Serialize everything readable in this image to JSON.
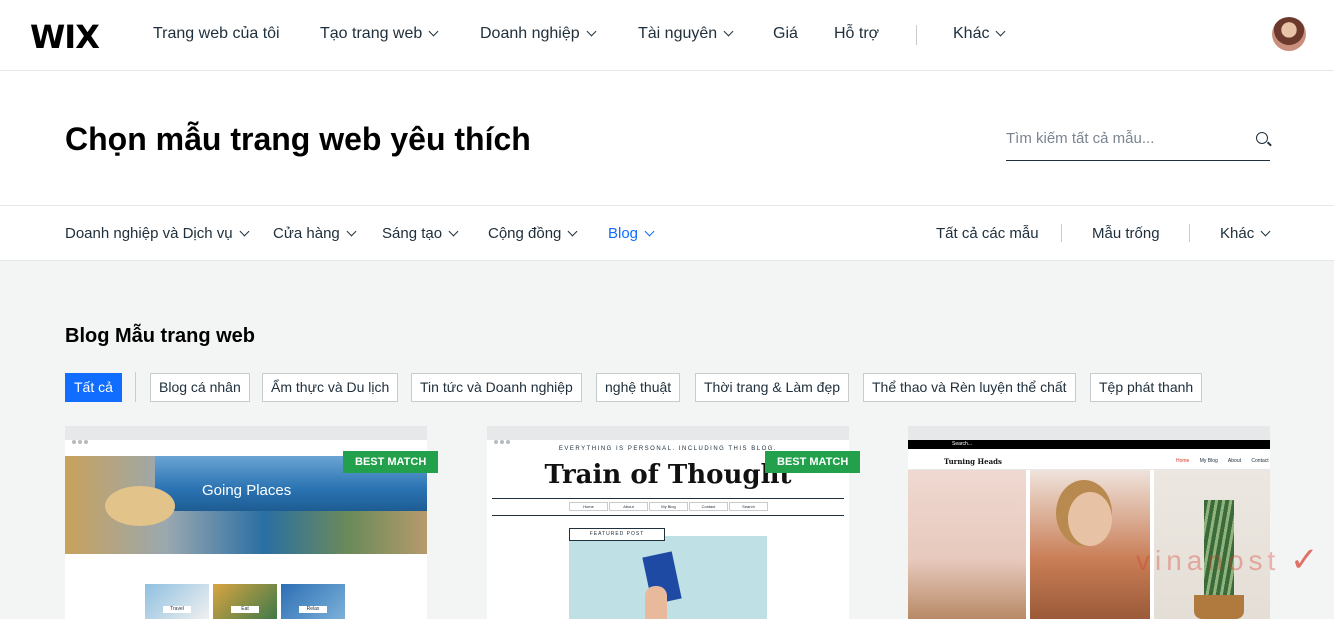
{
  "topnav": {
    "logo": "WIX",
    "items": [
      "Trang web của tôi",
      "Tạo trang web",
      "Doanh nghiệp",
      "Tài nguyên",
      "Giá",
      "Hỗ trợ",
      "Khác"
    ]
  },
  "hero": {
    "title": "Chọn mẫu trang web yêu thích",
    "search_placeholder": "Tìm kiếm tất cả mẫu..."
  },
  "subnav": {
    "left": [
      "Doanh nghiệp và Dịch vụ",
      "Cửa hàng",
      "Sáng tạo",
      "Cộng đồng",
      "Blog"
    ],
    "right": [
      "Tất cả các mẫu",
      "Mẫu trống",
      "Khác"
    ]
  },
  "section": {
    "title": "Blog Mẫu trang web",
    "chips": [
      "Tất cả",
      "Blog cá nhân",
      "Ẩm thực và Du lịch",
      "Tin tức và Doanh nghiệp",
      "nghệ thuật",
      "Thời trang & Làm đẹp",
      "Thể thao và Rèn luyện thể chất",
      "Tệp phát thanh"
    ]
  },
  "cards": {
    "badge": "BEST MATCH",
    "card1": {
      "title": "Going Places",
      "tiles": [
        "Travel",
        "Eat",
        "Relax"
      ]
    },
    "card2": {
      "tagline": "EVERYTHING IS PERSONAL. INCLUDING THIS BLOG.",
      "title": "Train of Thought",
      "menu": [
        "Home",
        "About",
        "My Blog",
        "Contact",
        "Search"
      ],
      "featured": "FEATURED POST"
    },
    "card3": {
      "search": "Search...",
      "logo": "Turning Heads",
      "menu": [
        "Home",
        "My Blog",
        "About",
        "Contact"
      ]
    }
  },
  "watermark": "vinanost",
  "colors": {
    "accent": "#116dff",
    "badge": "#22a04b"
  }
}
